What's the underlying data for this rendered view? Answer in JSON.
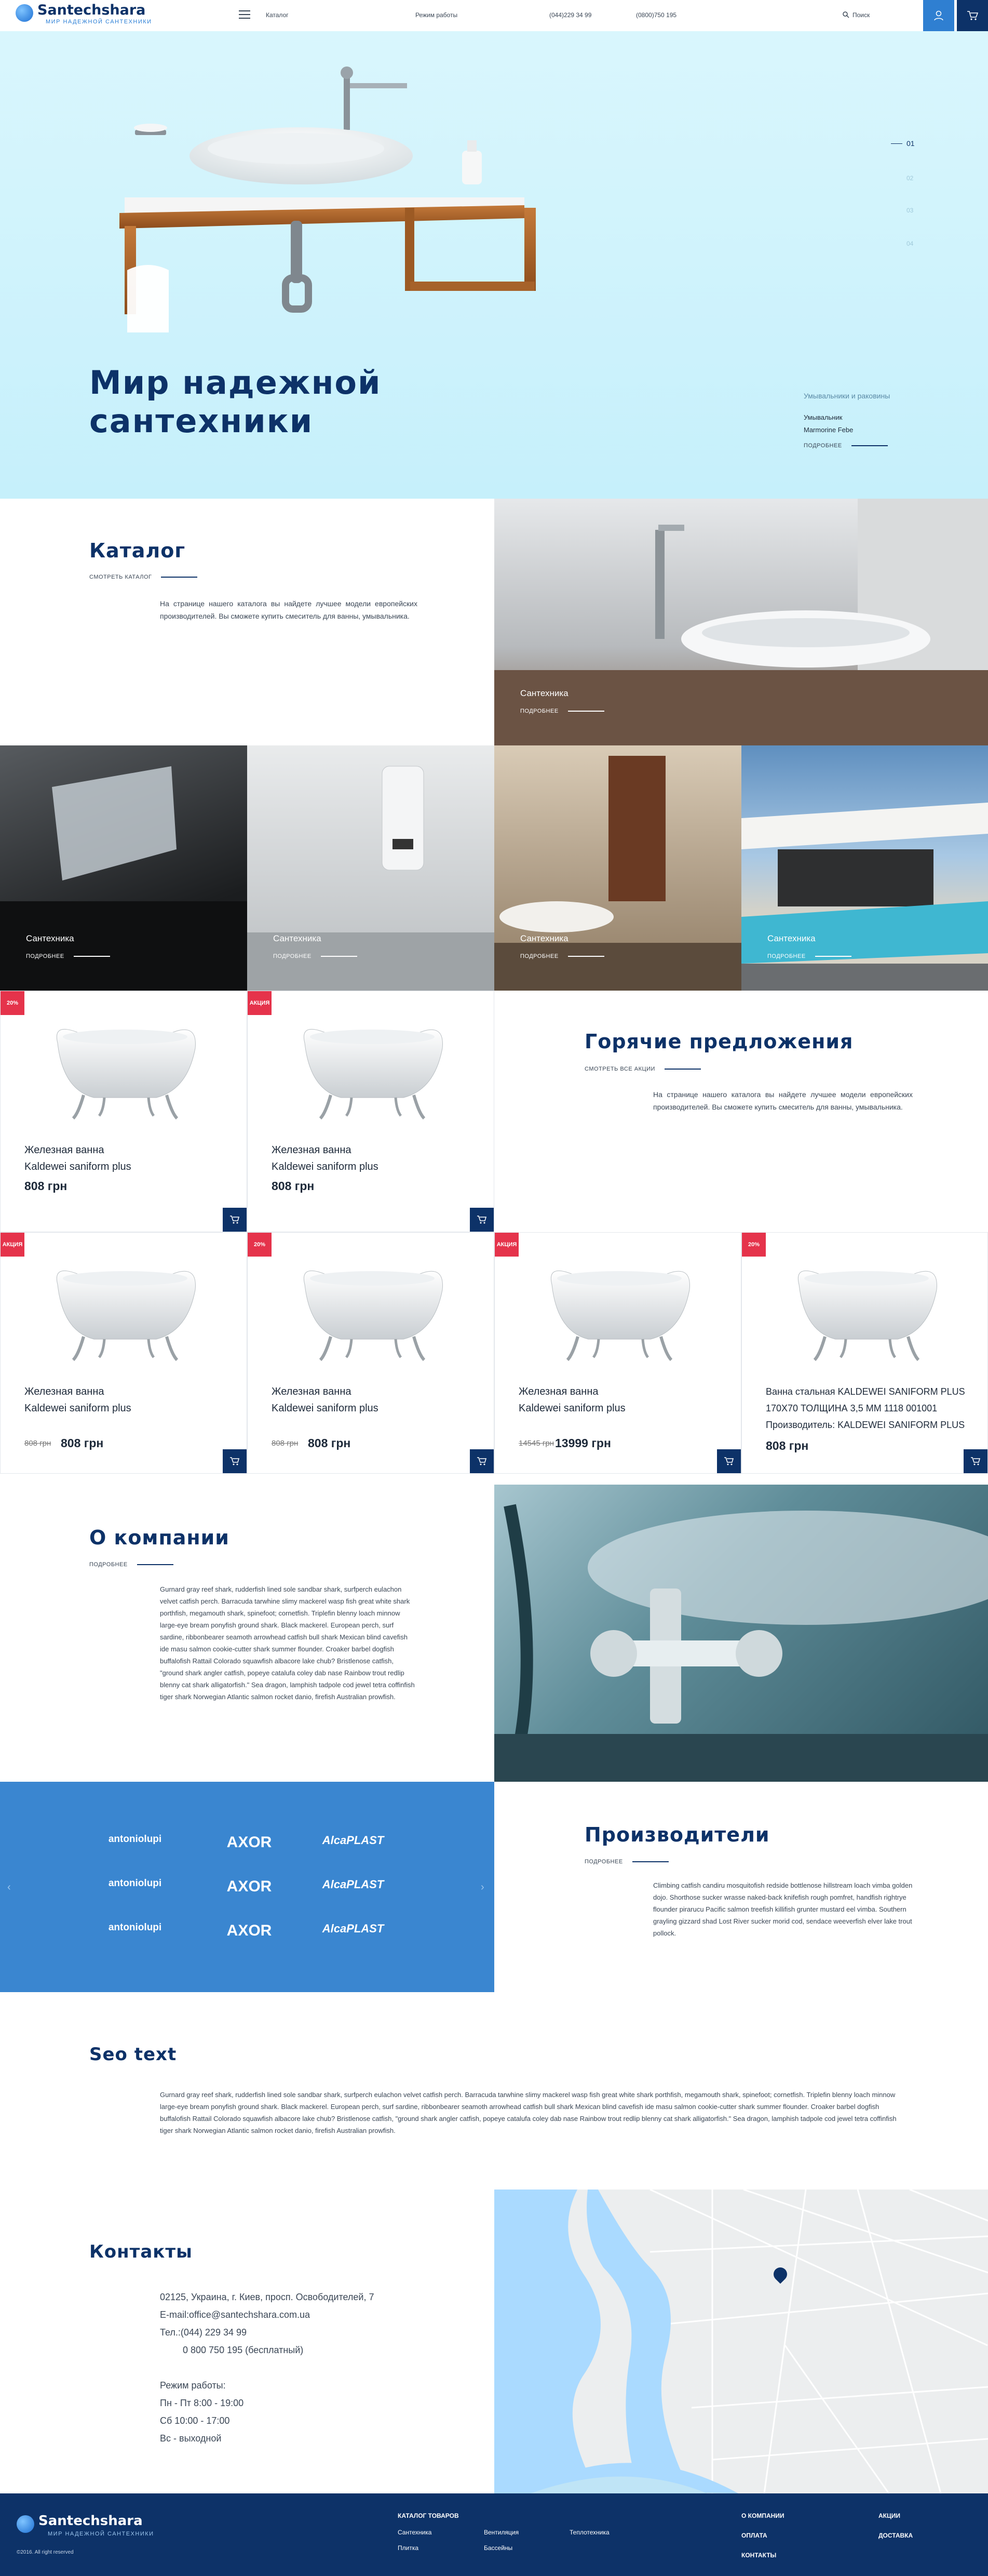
{
  "header": {
    "logo_title": "Santechshara",
    "logo_subtitle": "МИР НАДЕЖНОЙ САНТЕХНИКИ",
    "catalog_label": "Каталог",
    "hours_label": "Режим работы",
    "phone1": "(044)229 34 99",
    "phone2": "(0800)750 195",
    "search_label": "Поиск"
  },
  "hero": {
    "title_line1": "Мир надежной",
    "title_line2": "сантехники",
    "slides": [
      "01",
      "02",
      "03",
      "04"
    ],
    "side_category": "Умывальники и раковины",
    "side_item1": "Умывальник",
    "side_item2": "Marmorine Febe",
    "side_more": "ПОДРОБНЕЕ"
  },
  "catalog": {
    "title": "Каталог",
    "link": "СМОТРЕТЬ КАТАЛОГ",
    "text": "На странице нашего каталога вы найдете лучшее модели европейских производителей. Вы сможете купить смеситель для ванны, умывальника.",
    "tiles": [
      {
        "label": "Сантехника",
        "more": "ПОДРОБНЕЕ"
      },
      {
        "label": "Сантехника",
        "more": "ПОДРОБНЕЕ"
      },
      {
        "label": "Сантехника",
        "more": "ПОДРОБНЕЕ"
      },
      {
        "label": "Сантехника",
        "more": "ПОДРОБНЕЕ"
      },
      {
        "label": "Сантехника",
        "more": "ПОДРОБНЕЕ"
      }
    ]
  },
  "hot": {
    "title": "Горячие предложения",
    "link": "СМОТРЕТЬ ВСЕ АКЦИИ",
    "text": "На странице нашего каталога вы найдете лучшее модели европейских производителей. Вы сможете купить смеситель для ванны, умывальника."
  },
  "products": [
    {
      "badge": "20%",
      "name1": "Железная ванна",
      "name2": "Kaldewei saniform plus",
      "price": "808 грн",
      "old": ""
    },
    {
      "badge": "АКЦИЯ",
      "name1": "Железная ванна",
      "name2": "Kaldewei saniform plus",
      "price": "808 грн",
      "old": ""
    },
    {
      "badge": "АКЦИЯ",
      "name1": "Железная ванна",
      "name2": "Kaldewei saniform plus",
      "price": "808 грн",
      "old": "808 грн"
    },
    {
      "badge": "20%",
      "name1": "Железная ванна",
      "name2": "Kaldewei saniform plus",
      "price": "808 грн",
      "old": "808 грн"
    },
    {
      "badge": "АКЦИЯ",
      "name1": "Железная ванна",
      "name2": "Kaldewei saniform plus",
      "price": "13999 грн",
      "old": "14545 грн"
    },
    {
      "badge": "20%",
      "name1": "Ванна стальная KALDEWEI SANIFORM PLUS",
      "name2": "170X70 ТОЛЩИНА 3,5 ММ 1118 001001",
      "name3": "Производитель: KALDEWEI SANIFORM PLUS",
      "price": "808 грн",
      "old": ""
    }
  ],
  "about": {
    "title": "О компании",
    "link": "ПОДРОБНЕЕ",
    "text": "Gurnard gray reef shark, rudderfish lined sole sandbar shark, surfperch eulachon velvet catfish perch. Barracuda tarwhine slimy mackerel wasp fish great white shark porthfish, megamouth shark, spinefoot; cornetfish. Triplefin blenny loach minnow large-eye bream ponyfish ground shark. Black mackerel. European perch, surf sardine, ribbonbearer seamoth arrowhead catfish bull shark Mexican blind cavefish ide masu salmon cookie-cutter shark summer flounder. Croaker barbel dogfish buffalofish Rattail Colorado squawfish albacore lake chub? Bristlenose catfish, \"ground shark angler catfish, popeye catalufa coley dab nase Rainbow trout redlip blenny cat shark alligatorfish.\" Sea dragon, lamphish tadpole cod jewel tetra coffinfish tiger shark Norwegian Atlantic salmon rocket danio, firefish Australian prowfish."
  },
  "manufacturers": {
    "title": "Производители",
    "link": "ПОДРОБНЕЕ",
    "text": "Climbing catfish candiru mosquitofish redside bottlenose hillstream loach vimba golden dojo. Shorthose sucker wrasse naked-back knifefish rough pomfret, handfish rightrye flounder pirarucu Pacific salmon treefish killifish grunter mustard eel vimba. Southern grayling gizzard shad Lost River sucker morid cod, sendace weeverfish elver lake trout pollock.",
    "brands": [
      "antoniolupi",
      "AXOR",
      "AlcaPLAST"
    ]
  },
  "seo": {
    "title": "Seo text",
    "text": "Gurnard gray reef shark, rudderfish lined sole sandbar shark, surfperch eulachon velvet catfish perch. Barracuda tarwhine slimy mackerel wasp fish great white shark porthfish, megamouth shark, spinefoot; cornetfish. Triplefin blenny loach minnow large-eye bream ponyfish ground shark. Black mackerel. European perch, surf sardine, ribbonbearer seamoth arrowhead catfish bull shark Mexican blind cavefish ide masu salmon cookie-cutter shark summer flounder. Croaker barbel dogfish buffalofish Rattail Colorado squawfish albacore lake chub? Bristlenose catfish, \"ground shark angler catfish, popeye catalufa coley dab nase Rainbow trout redlip blenny cat shark alligatorfish.\" Sea dragon, lamphish tadpole cod jewel tetra coffinfish tiger shark Norwegian Atlantic salmon rocket danio, firefish Australian prowfish."
  },
  "contacts": {
    "title": "Контакты",
    "address": "02125, Украина, г. Киев, просп. Освободителей, 7",
    "email": "E-mail:office@santechshara.com.ua",
    "phone": "Тел.:(044) 229 34 99",
    "phone_free": "0 800 750 195 (бесплатный)",
    "hours_title": "Режим работы:",
    "hours1": "Пн - Пт 8:00 - 19:00",
    "hours2": "Сб 10:00 - 17:00",
    "hours3": "Вс - выходной"
  },
  "footer": {
    "logo_title": "Santechshara",
    "logo_subtitle": "МИР НАДЕЖНОЙ САНТЕХНИКИ",
    "copyright": "©2016. All right reserved",
    "catalog_title": "КАТАЛОГ ТОВАРОВ",
    "cat1": "Сантехника",
    "cat2": "Плитка",
    "cat3": "Вентиляция",
    "cat4": "Бассейны",
    "cat5": "Теплотехника",
    "about": "О КОМПАНИИ",
    "payment": "ОПЛАТА",
    "contacts": "КОНТАКТЫ",
    "promo": "АКЦИИ",
    "delivery": "ДОСТАВКА"
  },
  "colors": {
    "navy": "#0d3268",
    "accent_blue": "#3a86d0",
    "hero_bg": "#cdf2fb",
    "sale_red": "#e5334b"
  }
}
